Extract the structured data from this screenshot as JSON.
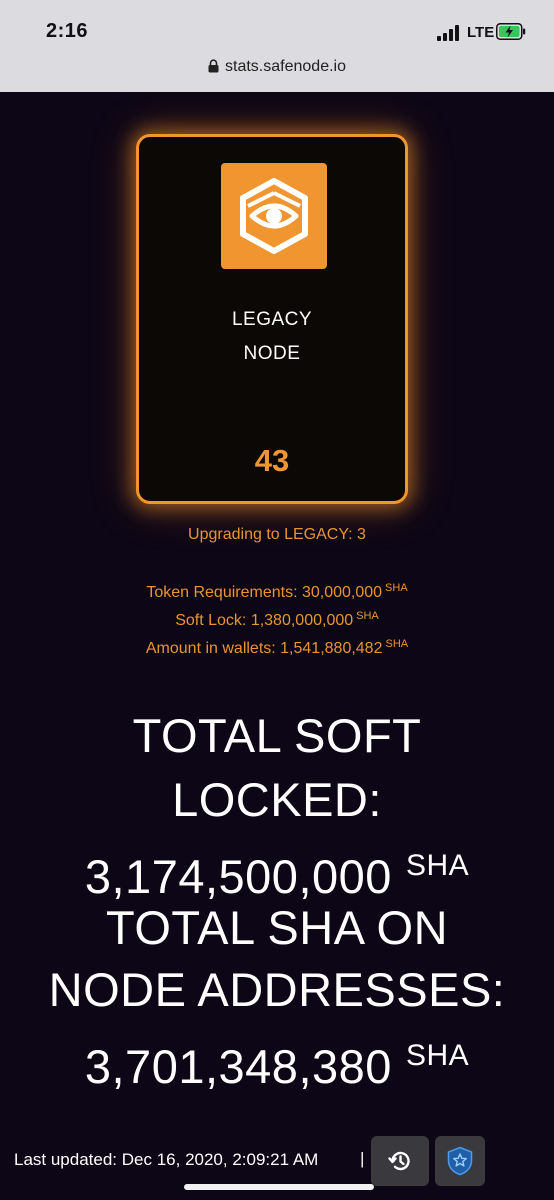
{
  "status_bar": {
    "time": "2:16",
    "network": "LTE",
    "url": "stats.safenode.io",
    "icons": [
      "signal-icon",
      "battery-charging-icon",
      "lock-icon"
    ]
  },
  "node_card": {
    "logo_icon": "safenode-eye-logo-icon",
    "title_line1": "LEGACY",
    "title_line2": "NODE",
    "count": "43"
  },
  "info": {
    "upgrading": "Upgrading to LEGACY: 3",
    "token_requirements": "Token Requirements: 30,000,000",
    "soft_lock": "Soft Lock: 1,380,000,000",
    "amount_in_wallets": "Amount in wallets: 1,541,880,482",
    "unit": "SHA"
  },
  "totals": {
    "soft_locked_line1": "TOTAL SOFT",
    "soft_locked_line2": "LOCKED:",
    "soft_locked_value": "3,174,500,000",
    "node_addresses_line1": "TOTAL SHA ON",
    "node_addresses_line2": "NODE ADDRESSES:",
    "node_addresses_value": "3,701,348,380",
    "unit": "SHA"
  },
  "footer": {
    "last_updated": "Last updated: Dec 16, 2020, 2:09:21 AM",
    "separator": "|",
    "history_icon": "history-icon",
    "badge_icon": "shield-star-icon"
  },
  "colors": {
    "background": "#0c0616",
    "accent": "#f0952f",
    "status_bar": "#dcdce0"
  }
}
